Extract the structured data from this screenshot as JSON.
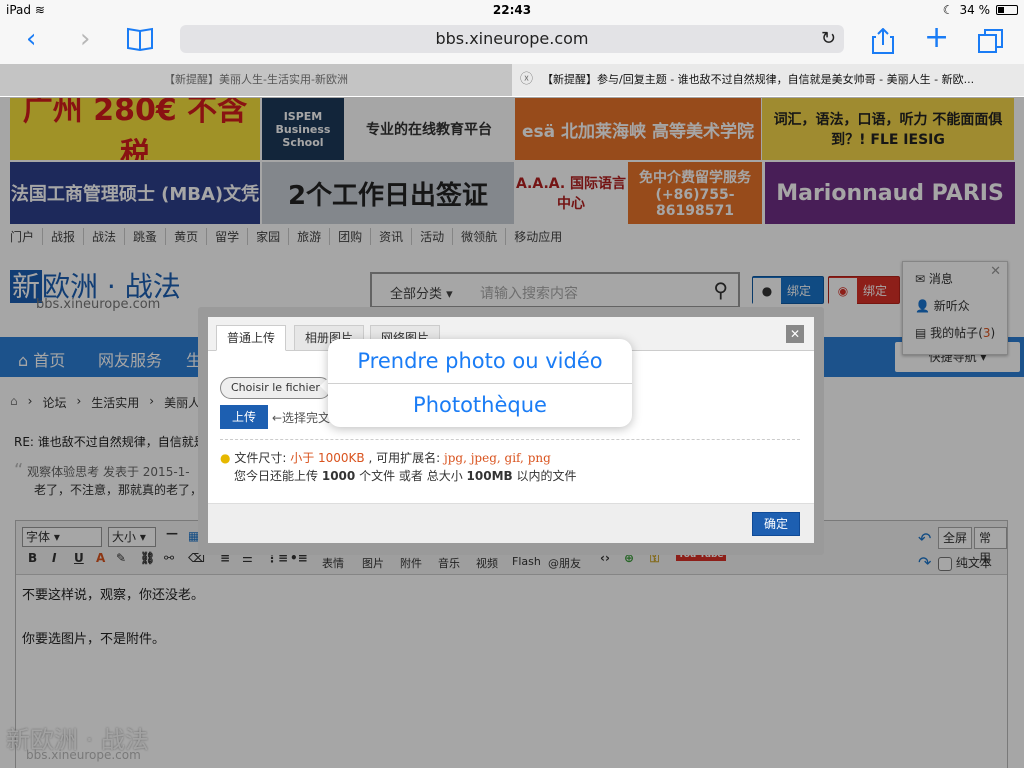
{
  "status": {
    "device": "iPad",
    "time": "22:43",
    "battery": "34 %"
  },
  "browser": {
    "url": "bbs.xineurope.com",
    "tabs": [
      {
        "title": "【新提醒】美丽人生-生活实用-新欧洲"
      },
      {
        "title": "【新提醒】参与/回复主题 - 谁也敌不过自然规律，自信就是美女帅哥 - 美丽人生 - 新欧..."
      }
    ]
  },
  "banners": [
    {
      "text": "广州 280€ 不含税",
      "color": "#f6e13c",
      "fg": "#d31d1d"
    },
    {
      "text": "ISPEM Business School",
      "color": "#1c3a5a",
      "fg": "#ffffff"
    },
    {
      "text": "专业的在线教育平台",
      "color": "#ffffff",
      "fg": "#333333"
    },
    {
      "text": "esä 北加莱海峡 高等美术学院",
      "color": "#e8742a",
      "fg": "#ffffff"
    },
    {
      "text": "词汇，语法，口语，听力 不能面面俱到？! FLE IESIG",
      "color": "#f4d64b",
      "fg": "#222222"
    },
    {
      "text": "法国工商管理硕士 (MBA)文凭",
      "color": "#2d3f8c",
      "fg": "#ffffff"
    },
    {
      "text": "2个工作日出签证",
      "color": "#c9cfd8",
      "fg": "#222222"
    },
    {
      "text": "A.A.A. 国际语言中心",
      "color": "#ffffff",
      "fg": "#b21f1f"
    },
    {
      "text": "免中介费留学服务 (+86)755-86198571",
      "color": "#e8742a",
      "fg": "#ffffff"
    },
    {
      "text": "Marionnaud PARIS",
      "color": "#6f2e86",
      "fg": "#ffffff"
    }
  ],
  "topmenu": [
    "门户",
    "战报",
    "战法",
    "跳蚤",
    "黄页",
    "留学",
    "家园",
    "旅游",
    "团购",
    "资讯",
    "活动",
    "微领航",
    "移动应用"
  ],
  "logo": {
    "badge": "新",
    "name": "欧洲 · 战法",
    "url": "bbs.xineurope.com"
  },
  "search": {
    "category": "全部分类",
    "placeholder": "请输入搜索内容"
  },
  "bind": {
    "qq": "绑定",
    "weibo": "绑定"
  },
  "userpop": {
    "items": [
      "消息",
      "新听众",
      "我的帖子"
    ],
    "count": "3"
  },
  "nav": {
    "items": [
      "首页",
      "网友服务",
      "生活"
    ],
    "quick": "快捷导航"
  },
  "crumb": [
    "论坛",
    "生活实用",
    "美丽人生"
  ],
  "post": {
    "title": "RE: 谁也敌不过自然规律，自信就是美女帅哥",
    "meta": "观察体验思考 发表于 2015-1-",
    "quote": "老了，不注意，那就真的老了，"
  },
  "editor": {
    "font": "字体",
    "size": "大小",
    "tools": [
      "表情",
      "图片",
      "附件",
      "音乐",
      "视频",
      "Flash",
      "@朋友"
    ],
    "fullscreen": "全屏",
    "common": "常用",
    "plaintext": "纯文本",
    "content": [
      "不要这样说，观察，你还没老。",
      "你要选图片，不是附件。"
    ]
  },
  "watermark": {
    "text": "新欧洲 · 战法",
    "url": "bbs.xineurope.com"
  },
  "dialog": {
    "tabs": [
      "普通上传",
      "相册图片",
      "网络图片"
    ],
    "choose": "Choisir le fichier",
    "upload": "上传",
    "hint": "←选择完文件后请点击上传",
    "size_label": "文件尺寸:",
    "size_value": "小于 1000KB",
    "ext_label": ", 可用扩展名:",
    "ext_value": "jpg, jpeg, gif, png",
    "quota_pre": "您今日还能上传",
    "quota_count": "1000",
    "quota_mid": "个文件 或者 总大小",
    "quota_size": "100MB",
    "quota_post": "以内的文件",
    "confirm": "确定"
  },
  "popover": {
    "options": [
      "Prendre photo ou vidéo",
      "Photothèque"
    ]
  }
}
